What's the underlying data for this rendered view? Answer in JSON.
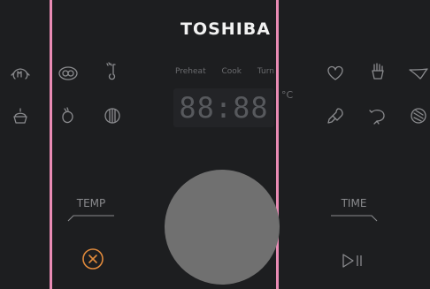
{
  "brand": "TOSHIBA",
  "status_labels": {
    "preheat": "Preheat",
    "cook": "Cook",
    "turn": "Turn"
  },
  "display": {
    "digits": "88:88",
    "unit": "°C"
  },
  "controls": {
    "temp_label": "TEMP",
    "time_label": "TIME"
  },
  "colors": {
    "accent_line": "#e98bb4",
    "cancel": "#e08a3c",
    "knob": "#707070",
    "background": "#1d1e20"
  },
  "icons": {
    "left": [
      "defrost-icon",
      "pizza-icon",
      "temperature-icon",
      "cake-icon",
      "potato-icon",
      "vegetable-icon"
    ],
    "right": [
      "heart-icon",
      "fries-icon",
      "wing-icon",
      "chicken-leg-icon",
      "shrimp-icon",
      "steak-icon"
    ],
    "bottom": [
      "cancel-icon",
      "start-pause-icon"
    ]
  }
}
